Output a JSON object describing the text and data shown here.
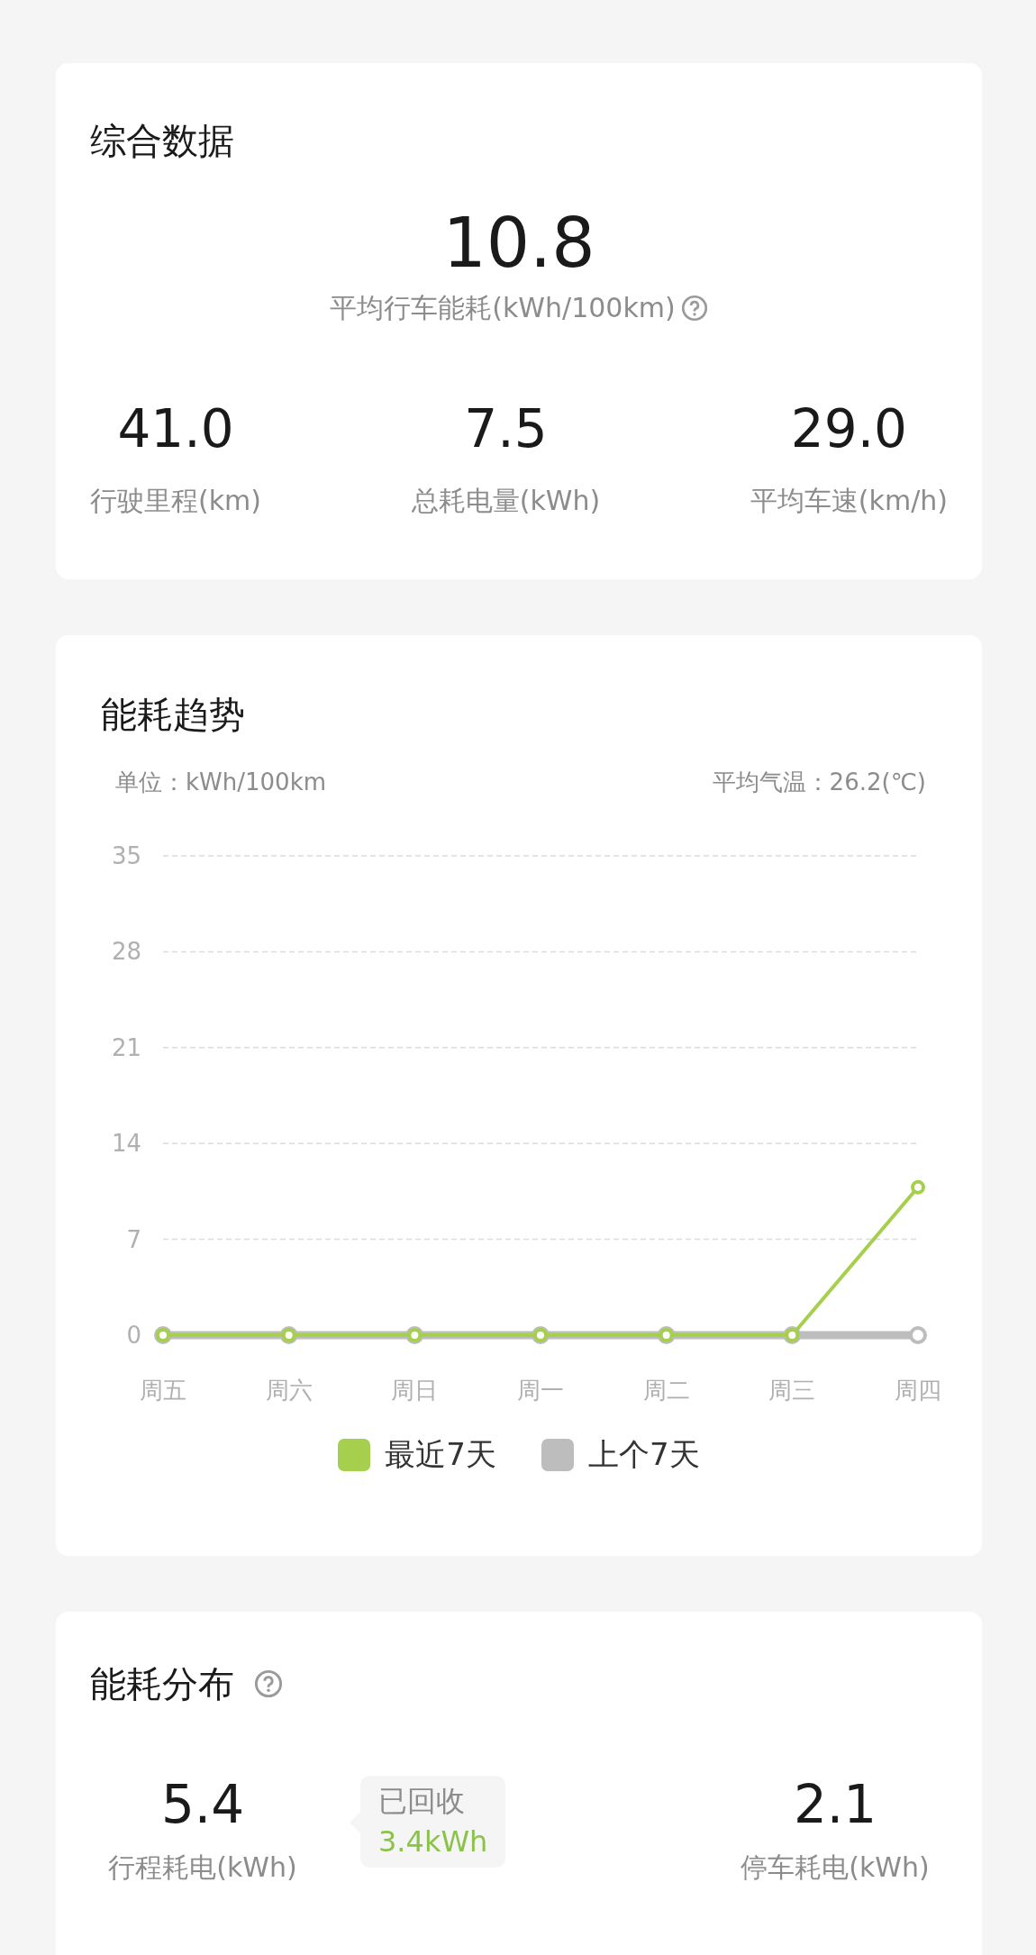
{
  "summary": {
    "title": "综合数据",
    "main_value": "10.8",
    "main_label": "平均行车能耗(kWh/100km)",
    "stats": [
      {
        "value": "41.0",
        "label": "行驶里程(km)"
      },
      {
        "value": "7.5",
        "label": "总耗电量(kWh)"
      },
      {
        "value": "29.0",
        "label": "平均车速(km/h)"
      }
    ]
  },
  "trend": {
    "title": "能耗趋势",
    "unit": "单位：kWh/100km",
    "temperature": "平均气温：26.2(℃)",
    "chart_data": {
      "type": "line",
      "categories": [
        "周五",
        "周六",
        "周日",
        "周一",
        "周二",
        "周三",
        "周四"
      ],
      "ylim": [
        0,
        35
      ],
      "grid": true,
      "yticks": [
        0,
        7,
        14,
        21,
        28,
        35
      ],
      "series": [
        {
          "name": "上个7天",
          "color": "#bdbdbd",
          "marker": "circle",
          "values": [
            0,
            0,
            0,
            0,
            0,
            0,
            0
          ]
        },
        {
          "name": "最近7天",
          "color": "#a5cf4c",
          "marker": "circle",
          "values": [
            0,
            0,
            0,
            0,
            0,
            0,
            10.8
          ]
        }
      ]
    }
  },
  "distribution": {
    "title": "能耗分布",
    "items": [
      {
        "value": "5.4",
        "label": "行程耗电(kWh)"
      },
      {
        "value": "2.1",
        "label": "停车耗电(kWh)"
      }
    ],
    "recovered": {
      "label": "已回收",
      "value": "3.4kWh"
    }
  }
}
